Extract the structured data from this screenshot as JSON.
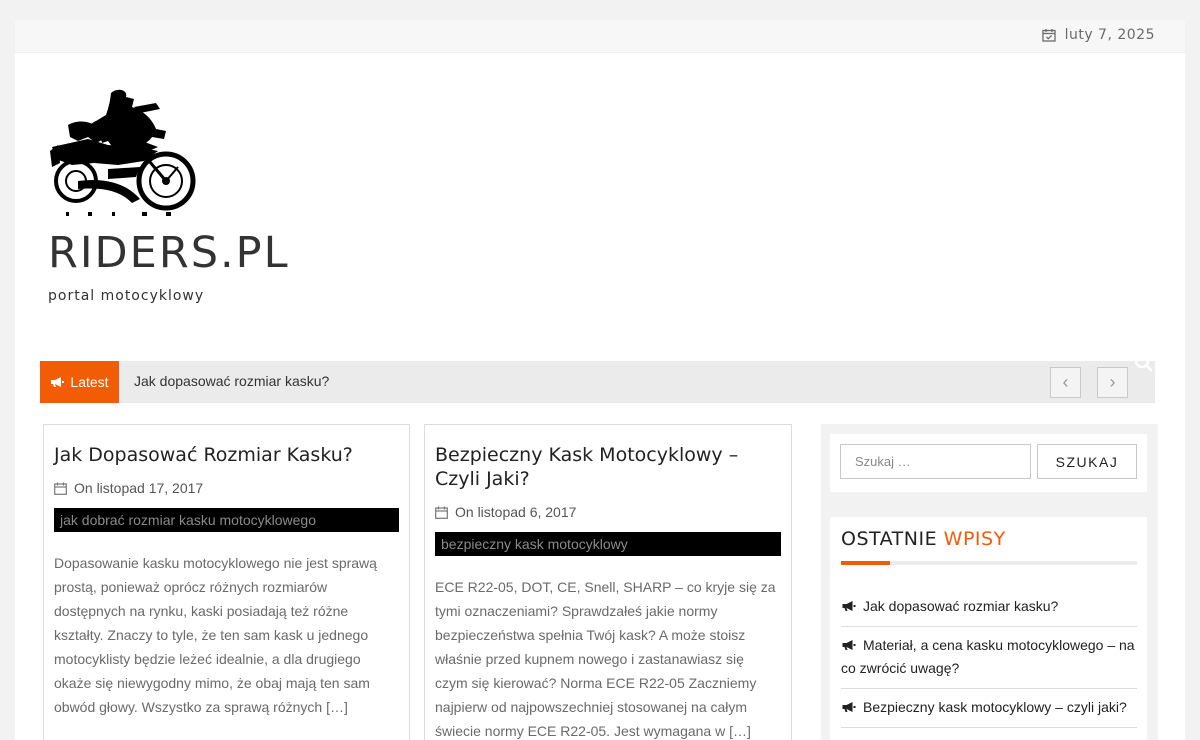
{
  "topbar": {
    "date": "luty 7, 2025"
  },
  "site": {
    "title": "RIDERS.PL",
    "tagline": "portal motocyklowy"
  },
  "ticker": {
    "label": "Latest",
    "headline": "Jak dopasować rozmiar kasku?",
    "prev_glyph": "‹",
    "next_glyph": "›"
  },
  "posts": [
    {
      "title": "Jak Dopasować Rozmiar Kasku?",
      "date": "On listopad 17, 2017",
      "image_alt": "jak dobrać rozmiar kasku motocyklowego",
      "excerpt_lines": [
        "Dopasowanie kasku motocyklowego nie jest sprawą",
        "prostą, ponieważ oprócz różnych rozmiarów",
        "dostępnych na rynku, kaski posiadają też różne",
        "kształty. Znaczy to tyle, że ten sam kask u jednego",
        "motocyklisty będzie leżeć idealnie, a dla drugiego",
        "okaże się niewygodny mimo, że obaj mają ten sam",
        "obwód głowy. Wszystko za sprawą różnych […]"
      ]
    },
    {
      "title": "Bezpieczny Kask Motocyklowy – Czyli Jaki?",
      "date": "On listopad 6, 2017",
      "image_alt": "bezpieczny kask motocyklowy",
      "excerpt_lines": [
        "ECE R22-05, DOT, CE, Snell, SHARP – co kryje się za",
        "tymi oznaczeniami? Sprawdzałeś jakie normy",
        "bezpieczeństwa spełnia Twój kask? A może stoisz",
        "właśnie przed kupnem nowego i zastanawiasz się",
        "czym się kierować? Norma ECE R22-05 Zaczniemy",
        "najpierw od najpowszechniej stosowanej na całym",
        "świecie normy ECE R22-05. Jest wymagana w […]"
      ]
    }
  ],
  "sidebar": {
    "search": {
      "placeholder": "Szukaj …",
      "button": "SZUKAJ"
    },
    "recent": {
      "title_part1": "OSTATNIE",
      "title_part2": "WPISY",
      "items": [
        "Jak dopasować rozmiar kasku?",
        "Materiał, a cena kasku motocyklowego – na co zwrócić uwagę?",
        "Bezpieczny kask motocyklowy – czyli jaki?"
      ]
    }
  },
  "colors": {
    "accent": "#f25c05",
    "text": "#333333",
    "muted": "#6a6a6a"
  }
}
